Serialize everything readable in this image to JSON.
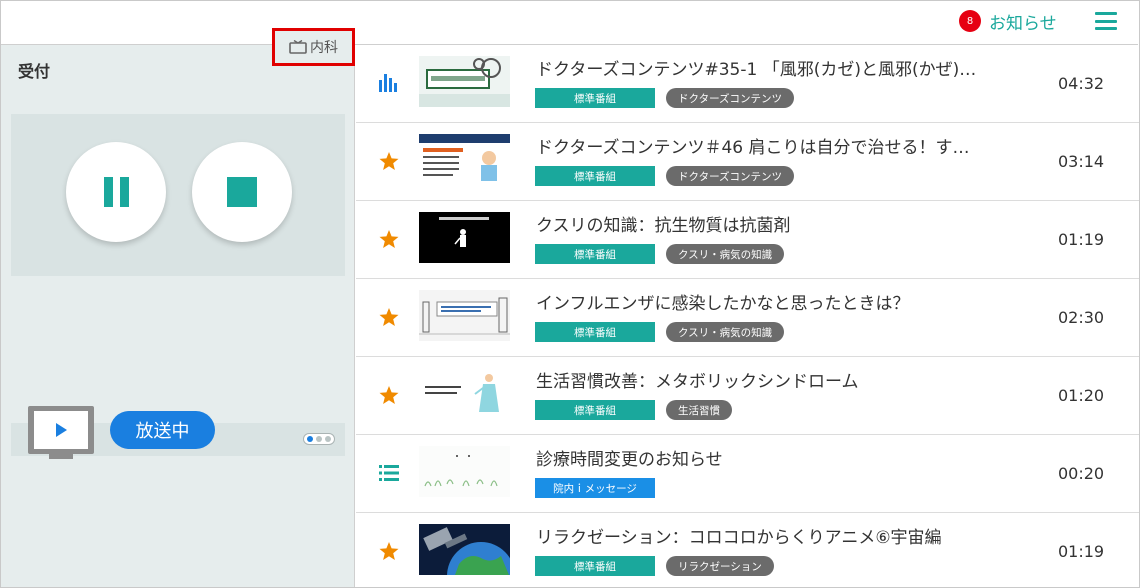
{
  "header": {
    "notification_count": "8",
    "notification_label": "お知らせ",
    "menu_icon": "hamburger-icon",
    "accent_color": "#1aa89c",
    "badge_color": "#e60012"
  },
  "left": {
    "reception_label": "受付",
    "department_label": "内科",
    "department_icon": "tv-icon",
    "pause_icon": "pause-icon",
    "stop_icon": "stop-icon",
    "monitor_icon": "monitor-play-icon",
    "onair_label": "放送中",
    "onair_color": "#1a7fe0"
  },
  "programs": [
    {
      "icon": "bar-chart-icon",
      "title": "ドクターズコンテンツ#35-1 「風邪(カゼ)と風邪(かぜ)…",
      "tag_standard": "標準番組",
      "tag_category": "ドクターズコンテンツ",
      "duration": "04:32"
    },
    {
      "icon": "star-icon",
      "title": "ドクターズコンテンツ＃46 肩こりは自分で治せる！す…",
      "tag_standard": "標準番組",
      "tag_category": "ドクターズコンテンツ",
      "duration": "03:14"
    },
    {
      "icon": "star-icon",
      "title": "クスリの知識：抗生物質は抗菌剤",
      "tag_standard": "標準番組",
      "tag_category": "クスリ・病気の知識",
      "duration": "01:19"
    },
    {
      "icon": "star-icon",
      "title": "インフルエンザに感染したかなと思ったときは？",
      "tag_standard": "標準番組",
      "tag_category": "クスリ・病気の知識",
      "duration": "02:30"
    },
    {
      "icon": "star-icon",
      "title": "生活習慣改善：メタボリックシンドローム",
      "tag_standard": "標準番組",
      "tag_category": "生活習慣",
      "duration": "01:20"
    },
    {
      "icon": "list-icon",
      "title": "診療時間変更のお知らせ",
      "tag_message": "院内ｉメッセージ",
      "duration": "00:20"
    },
    {
      "icon": "star-icon",
      "title": "リラクゼーション：コロコロからくりアニメ⑥宇宙編",
      "tag_standard": "標準番組",
      "tag_category": "リラクゼーション",
      "duration": "01:19"
    }
  ]
}
